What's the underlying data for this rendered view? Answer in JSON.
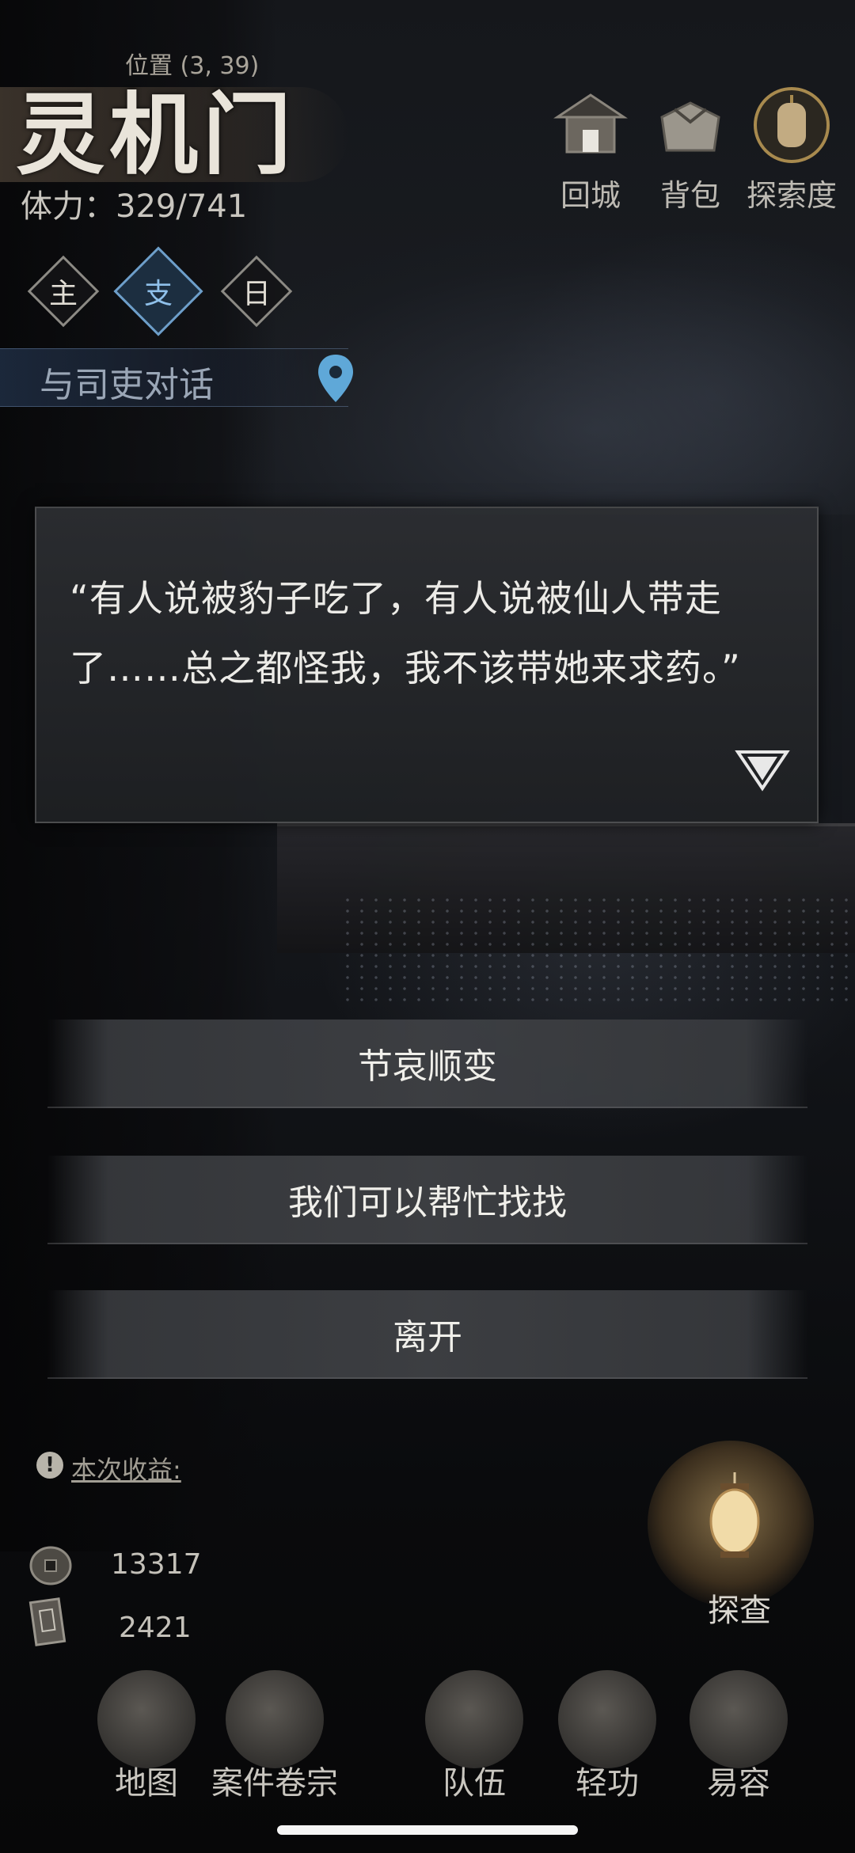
{
  "header": {
    "position": "位置 (3, 39)",
    "location_name": "灵机门",
    "stamina": "体力：329/741"
  },
  "quest_tabs": [
    {
      "label": "主",
      "active": false
    },
    {
      "label": "支",
      "active": true
    },
    {
      "label": "日",
      "active": false
    }
  ],
  "quest": {
    "text": "与司吏对话"
  },
  "top_buttons": {
    "return_city": "回城",
    "backpack": "背包",
    "exploration": "探索度"
  },
  "dialog": {
    "text": "“有人说被豹子吃了，有人说被仙人带走了……总之都怪我，我不该带她来求药。”"
  },
  "choices": [
    "节哀顺变",
    "我们可以帮忙找找",
    "离开"
  ],
  "earnings": {
    "label": "本次收益:",
    "coins": "13317",
    "notes": "2421"
  },
  "explore": {
    "label": "探查"
  },
  "nav": {
    "map": "地图",
    "case_files": "案件卷宗",
    "team": "队伍",
    "qinggong": "轻功",
    "disguise": "易容"
  },
  "icons": {
    "return_city": "pavilion-icon",
    "backpack": "bundle-icon",
    "exploration": "lantern-icon",
    "quest_pin": "map-pin-icon",
    "dialog_next": "triangle-down-icon",
    "earn_info": "exclamation-icon",
    "coin": "coin-icon",
    "note": "banknote-icon"
  },
  "colors": {
    "active_tab": "#6d9ec9",
    "quest_pin": "#5fa8d8",
    "background": "#0b0c0e"
  }
}
